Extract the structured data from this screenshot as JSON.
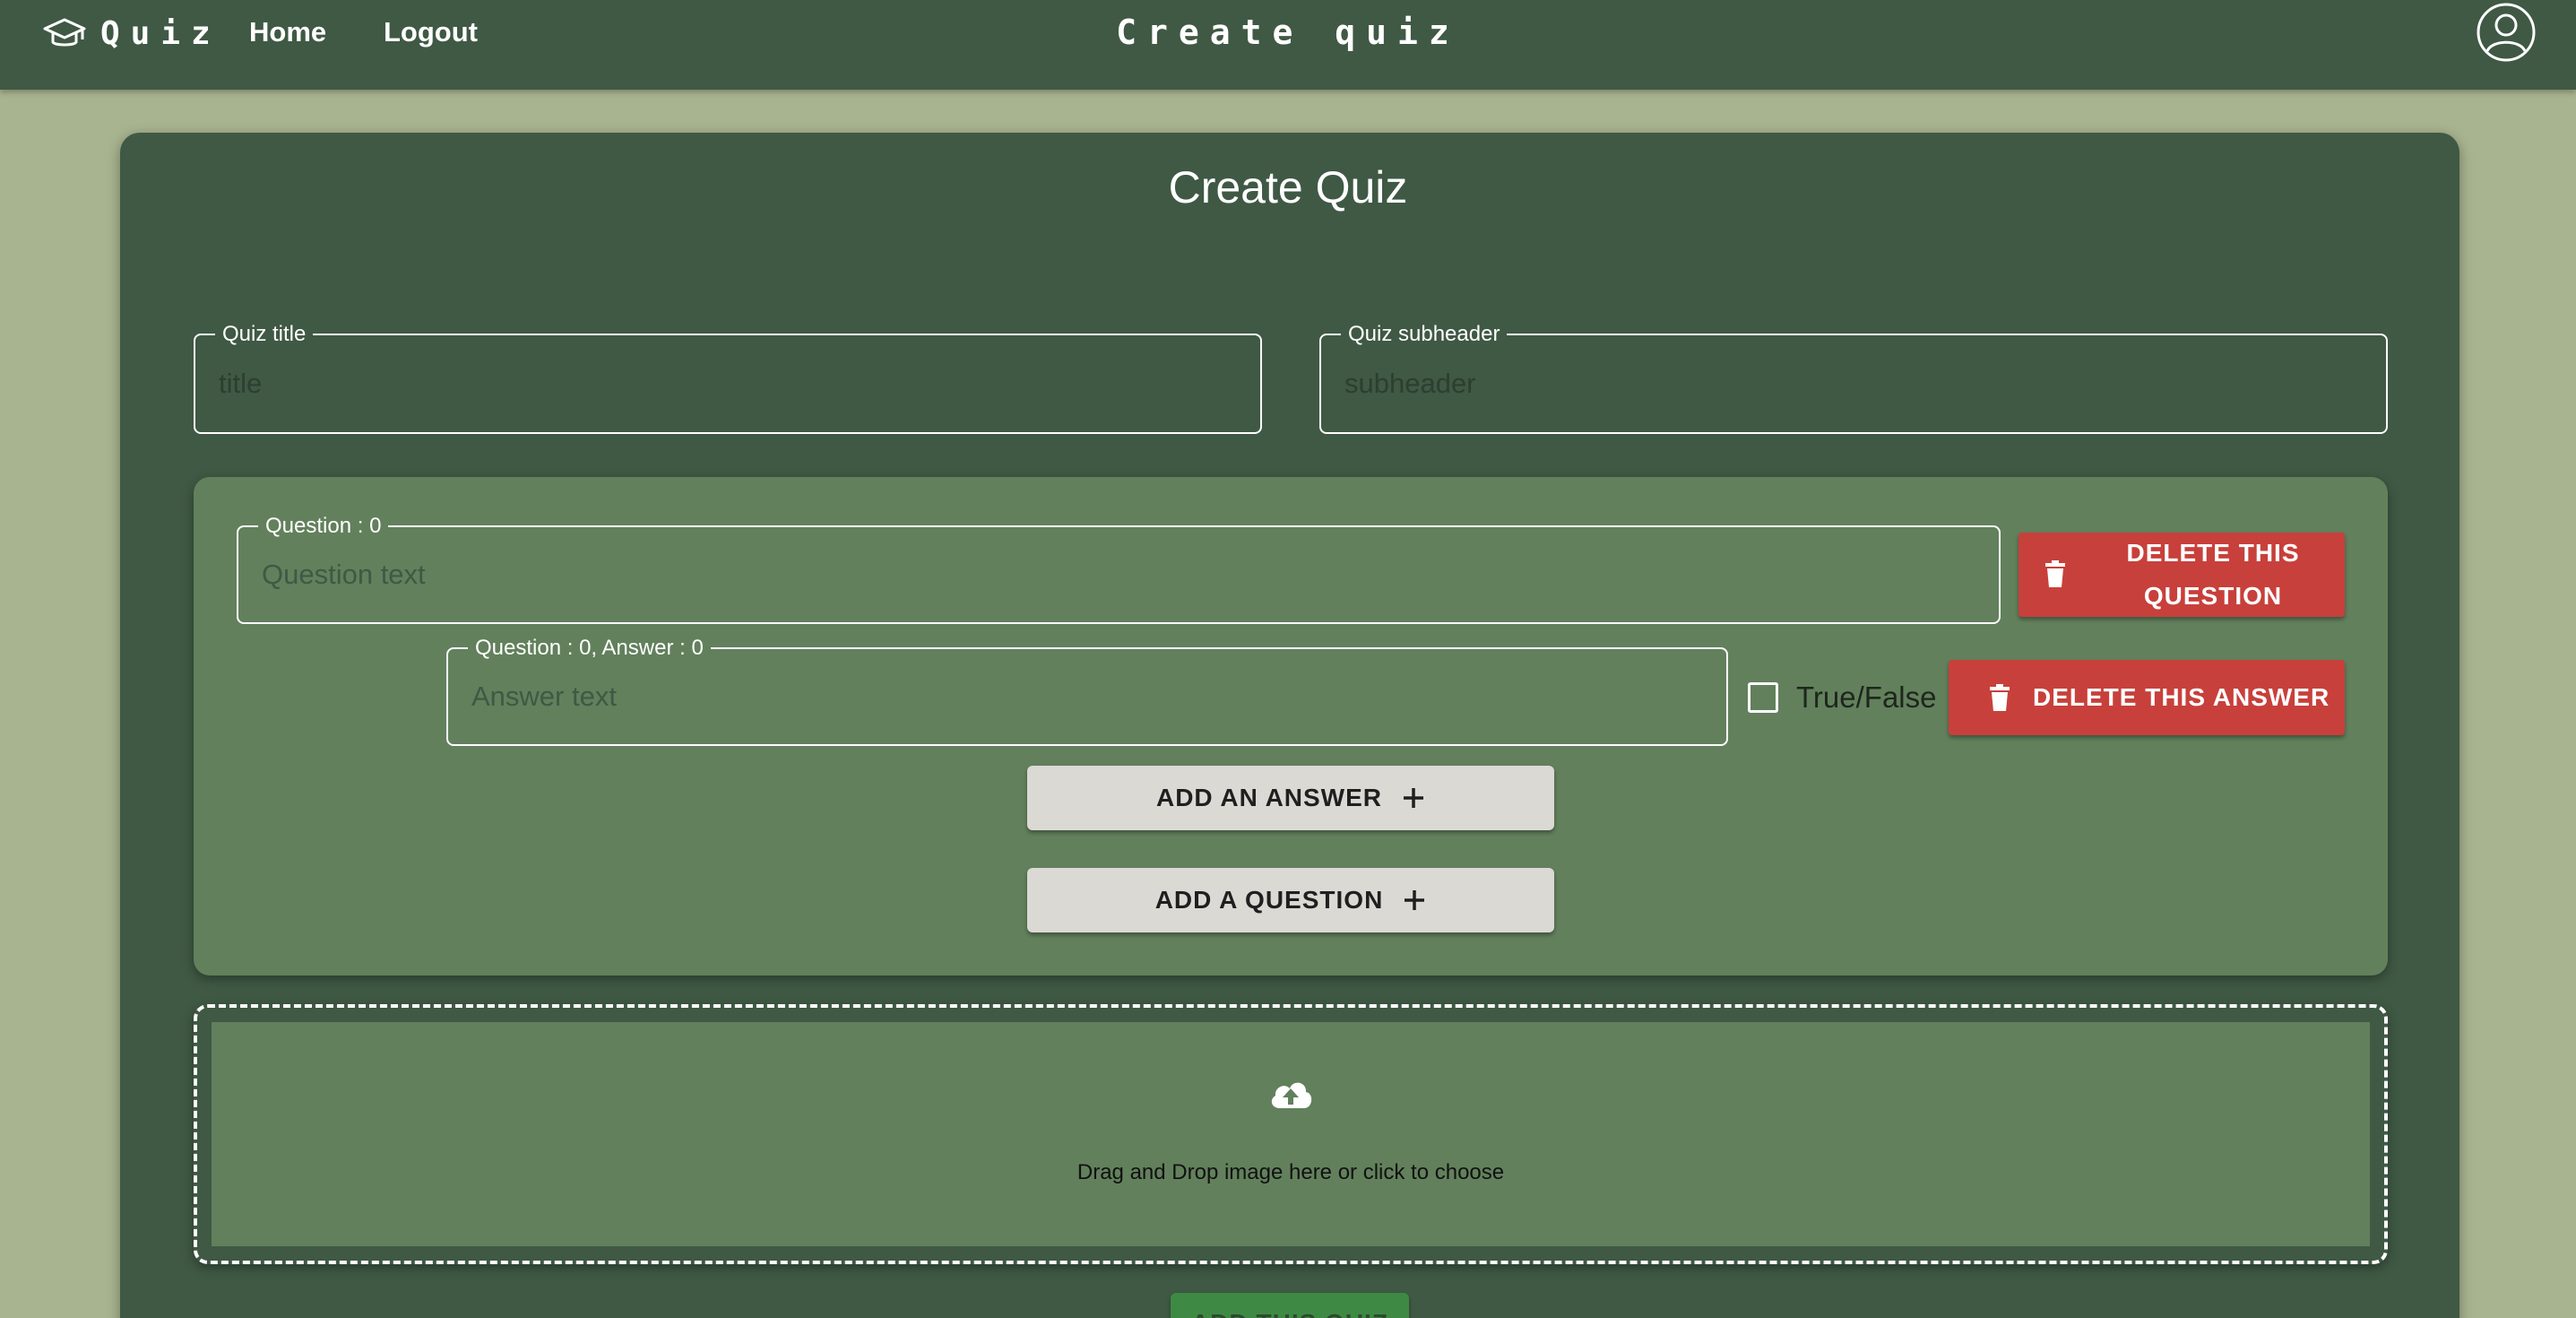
{
  "header": {
    "brand_text": "Quiz",
    "nav": {
      "home": "Home",
      "logout": "Logout"
    },
    "page_title": "Create quiz",
    "icons": {
      "brand": "graduation-cap-icon",
      "account": "account-circle-icon"
    }
  },
  "form": {
    "heading": "Create Quiz",
    "quiz_title": {
      "label": "Quiz title",
      "placeholder": "title",
      "value": ""
    },
    "quiz_subheader": {
      "label": "Quiz subheader",
      "placeholder": "subheader",
      "value": ""
    }
  },
  "question": {
    "label": "Question : 0",
    "placeholder": "Question text",
    "value": "",
    "delete_label": "DELETE THIS QUESTION",
    "answer": {
      "label": "Question : 0, Answer : 0",
      "placeholder": "Answer text",
      "value": "",
      "checkbox_label": "True/False",
      "checked": false,
      "delete_label": "DELETE THIS ANSWER"
    },
    "add_answer_label": "ADD AN ANSWER",
    "add_question_label": "ADD A QUESTION"
  },
  "dropzone": {
    "text": "Drag and Drop image here or click to choose",
    "icon": "cloud-upload-icon"
  },
  "submit": {
    "label": "ADD THIS QUIZ"
  },
  "colors": {
    "page_bg": "#a8b38f",
    "nav_bg": "#3f5944",
    "panel_bg": "#62805c",
    "danger": "#c8403b",
    "neutral_button": "#dbd9d4",
    "submit": "#3e8a44"
  }
}
